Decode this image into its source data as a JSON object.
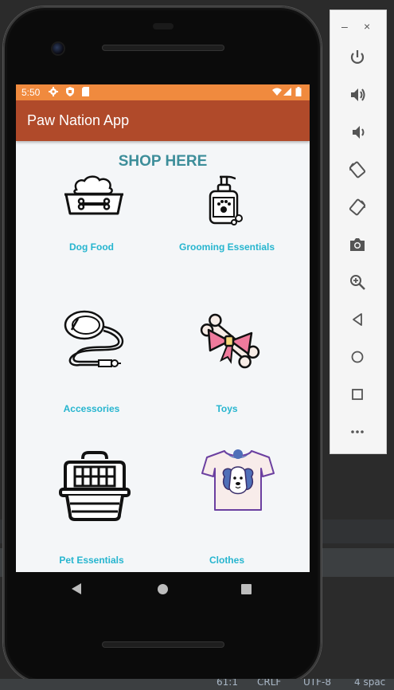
{
  "status_bar": {
    "time": "5:50"
  },
  "app_bar": {
    "title": "Paw Nation App"
  },
  "shop": {
    "heading": "SHOP HERE",
    "items": [
      {
        "label": "Dog Food",
        "icon": "dog-bowl-icon"
      },
      {
        "label": "Grooming Essentials",
        "icon": "pet-shampoo-icon"
      },
      {
        "label": "Accessories",
        "icon": "leash-icon"
      },
      {
        "label": "Toys",
        "icon": "bone-toy-icon"
      },
      {
        "label": "Pet Essentials",
        "icon": "pet-carrier-icon"
      },
      {
        "label": "Clothes",
        "icon": "dog-shirt-icon"
      }
    ]
  },
  "ide_status": {
    "position": "61:1",
    "line_ending": "CRLF",
    "encoding": "UTF-8",
    "indent": "4 spac"
  },
  "colors": {
    "status_bar": "#f08a3e",
    "app_bar": "#b04a2a",
    "heading": "#3d8e9a",
    "label": "#26b5cf",
    "screen_bg": "#f4f6f8"
  }
}
